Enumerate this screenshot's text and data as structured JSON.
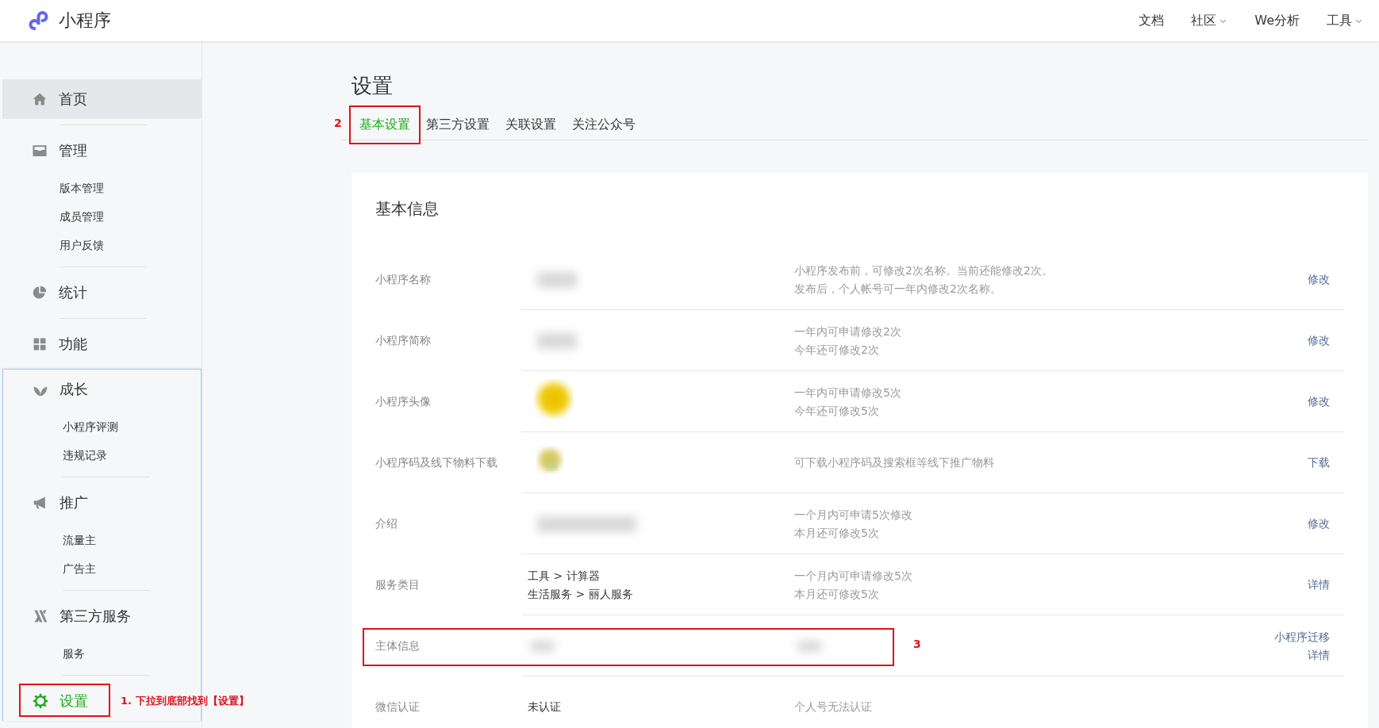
{
  "topbar": {
    "logo_text": "小程序",
    "nav": [
      {
        "label": "文档",
        "dropdown": false
      },
      {
        "label": "社区",
        "dropdown": true
      },
      {
        "label": "We分析",
        "dropdown": false
      },
      {
        "label": "工具",
        "dropdown": true
      }
    ]
  },
  "sidebar": {
    "panels": [
      {
        "framed": false,
        "sections": [
          {
            "label": "首页",
            "highlighted": true,
            "selected": false
          },
          {
            "label": "管理",
            "highlighted": false,
            "selected": false,
            "children": [
              {
                "label": "版本管理"
              },
              {
                "label": "成员管理"
              },
              {
                "label": "用户反馈"
              }
            ]
          },
          {
            "label": "统计",
            "highlighted": false,
            "selected": false
          },
          {
            "label": "功能",
            "highlighted": false,
            "selected": false
          }
        ]
      },
      {
        "framed": true,
        "sections": [
          {
            "label": "成长",
            "highlighted": false,
            "selected": false,
            "children": [
              {
                "label": "小程序评测"
              },
              {
                "label": "违规记录"
              }
            ]
          },
          {
            "label": "推广",
            "highlighted": false,
            "selected": false,
            "children": [
              {
                "label": "流量主"
              },
              {
                "label": "广告主"
              }
            ]
          },
          {
            "label": "第三方服务",
            "highlighted": false,
            "selected": false,
            "children": [
              {
                "label": "服务"
              }
            ]
          },
          {
            "label": "设置",
            "highlighted": false,
            "selected": true,
            "annotation": "1. 下拉到底部找到【设置】"
          }
        ]
      }
    ]
  },
  "main": {
    "title": "设置",
    "tabs": [
      {
        "label": "基本设置",
        "selected": true,
        "annotation": "2"
      },
      {
        "label": "第三方设置",
        "selected": false
      },
      {
        "label": "关联设置",
        "selected": false
      },
      {
        "label": "关注公众号",
        "selected": false
      }
    ],
    "card": {
      "title": "基本信息",
      "rows": [
        {
          "label": "小程序名称",
          "value": {
            "kind": "blurred"
          },
          "desc": {
            "kind": "text",
            "lines": [
              "小程序发布前，可修改2次名称。当前还能修改2次。",
              "发布后，个人帐号可一年内修改2次名称。"
            ]
          },
          "actions": [
            "修改"
          ]
        },
        {
          "label": "小程序简称",
          "value": {
            "kind": "blurred"
          },
          "desc": {
            "kind": "text",
            "lines": [
              "一年内可申请修改2次",
              "今年还可修改2次"
            ]
          },
          "actions": [
            "修改"
          ]
        },
        {
          "label": "小程序头像",
          "value": {
            "kind": "picture"
          },
          "desc": {
            "kind": "text",
            "lines": [
              "一年内可申请修改5次",
              "今年还可修改5次"
            ]
          },
          "actions": [
            "修改"
          ]
        },
        {
          "label": "小程序码及线下物料下载",
          "value": {
            "kind": "code"
          },
          "desc": {
            "kind": "text",
            "lines": [
              "可下载小程序码及搜索框等线下推广物料"
            ]
          },
          "actions": [
            "下载"
          ]
        },
        {
          "label": "介绍",
          "value": {
            "kind": "blurred_wide"
          },
          "desc": {
            "kind": "text",
            "lines": [
              "一个月内可申请5次修改",
              "本月还可修改5次"
            ]
          },
          "actions": [
            "修改"
          ]
        },
        {
          "label": "服务类目",
          "value": {
            "kind": "text",
            "lines": [
              "工具 > 计算器",
              "生活服务 > 丽人服务"
            ]
          },
          "desc": {
            "kind": "text",
            "lines": [
              "一个月内可申请修改5次",
              "本月还可修改5次"
            ]
          },
          "actions": [
            "详情"
          ]
        },
        {
          "label": "主体信息",
          "annotation": "3",
          "value": {
            "kind": "blurred_small"
          },
          "desc": {
            "kind": "blurred_small"
          },
          "actions": [
            "小程序迁移",
            "详情"
          ]
        },
        {
          "label": "微信认证",
          "value": {
            "kind": "text",
            "lines": [
              "未认证"
            ]
          },
          "desc": {
            "kind": "text",
            "lines": [
              "个人号无法认证"
            ]
          },
          "actions": []
        }
      ]
    }
  }
}
